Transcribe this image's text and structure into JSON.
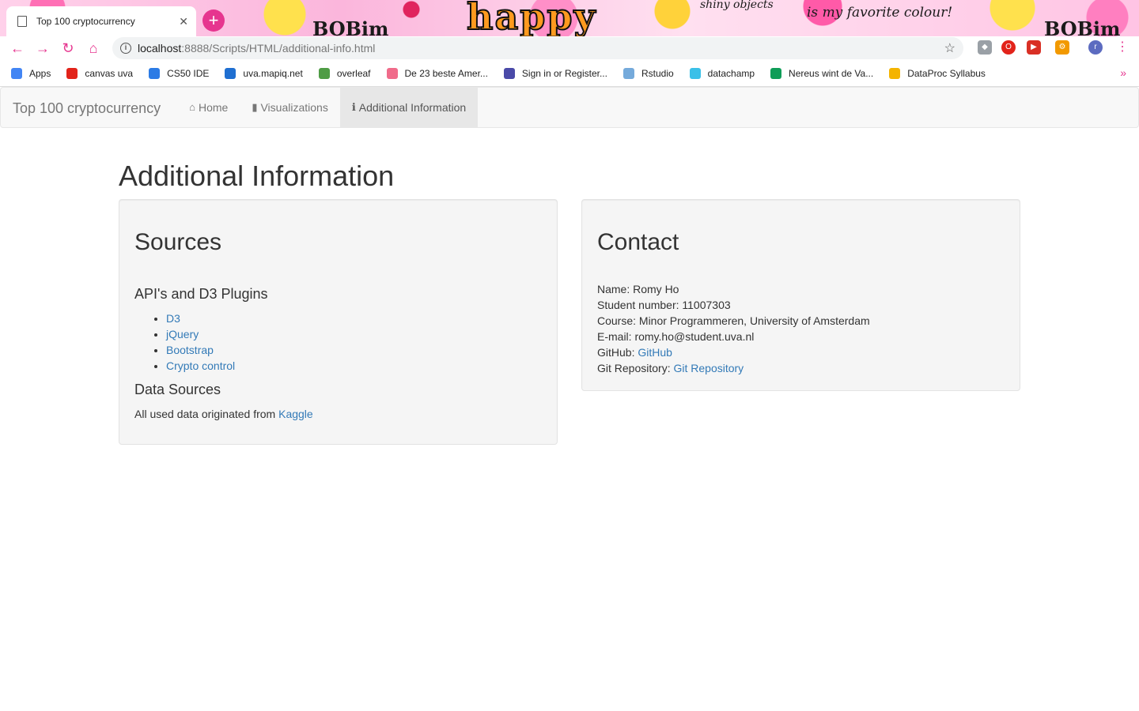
{
  "browser": {
    "tab_title": "Top 100 cryptocurrency",
    "url_host": "localhost",
    "url_path": ":8888/Scripts/HTML/additional-info.html",
    "decor": {
      "happy": "happy",
      "fav": "is my favorite colour!",
      "b1": "BOBim",
      "b2": "BOBim",
      "shiny": "shiny objects"
    },
    "bookmarks": [
      {
        "label": "Apps",
        "color": "#4285f4"
      },
      {
        "label": "canvas uva",
        "color": "#e2231a"
      },
      {
        "label": "CS50 IDE",
        "color": "#2c7be5"
      },
      {
        "label": "uva.mapiq.net",
        "color": "#1f6fd1"
      },
      {
        "label": "overleaf",
        "color": "#4f9c45"
      },
      {
        "label": "De 23 beste Amer...",
        "color": "#f06b8a"
      },
      {
        "label": "Sign in or Register...",
        "color": "#4a4aa8"
      },
      {
        "label": "Rstudio",
        "color": "#75aadb"
      },
      {
        "label": "datachamp",
        "color": "#3ac0e8"
      },
      {
        "label": "Nereus wint de Va...",
        "color": "#0f9d58"
      },
      {
        "label": "DataProc Syllabus",
        "color": "#f4b400"
      }
    ],
    "bookmarks_more": "»"
  },
  "navbar": {
    "brand": "Top 100 cryptocurrency",
    "items": [
      {
        "label": "Home",
        "icon": "home-icon",
        "glyph": "⌂"
      },
      {
        "label": "Visualizations",
        "icon": "bar-chart-icon",
        "glyph": "▮"
      },
      {
        "label": "Additional Information",
        "icon": "info-icon",
        "glyph": "ℹ"
      }
    ]
  },
  "main": {
    "title": "Additional Information",
    "sources": {
      "heading": "Sources",
      "plugins_heading": "API's and D3 Plugins",
      "plugins": [
        "D3",
        "jQuery",
        "Bootstrap",
        "Crypto control"
      ],
      "data_heading": "Data Sources",
      "data_text": "All used data originated from ",
      "data_link": "Kaggle"
    },
    "contact": {
      "heading": "Contact",
      "name": "Name: Romy Ho",
      "student_number": "Student number: 11007303",
      "course": "Course: Minor Programmeren, University of Amsterdam",
      "email": "E-mail: romy.ho@student.uva.nl",
      "github_label": "GitHub: ",
      "github_link": "GitHub",
      "repo_label": "Git Repository: ",
      "repo_link": "Git Repository"
    }
  }
}
